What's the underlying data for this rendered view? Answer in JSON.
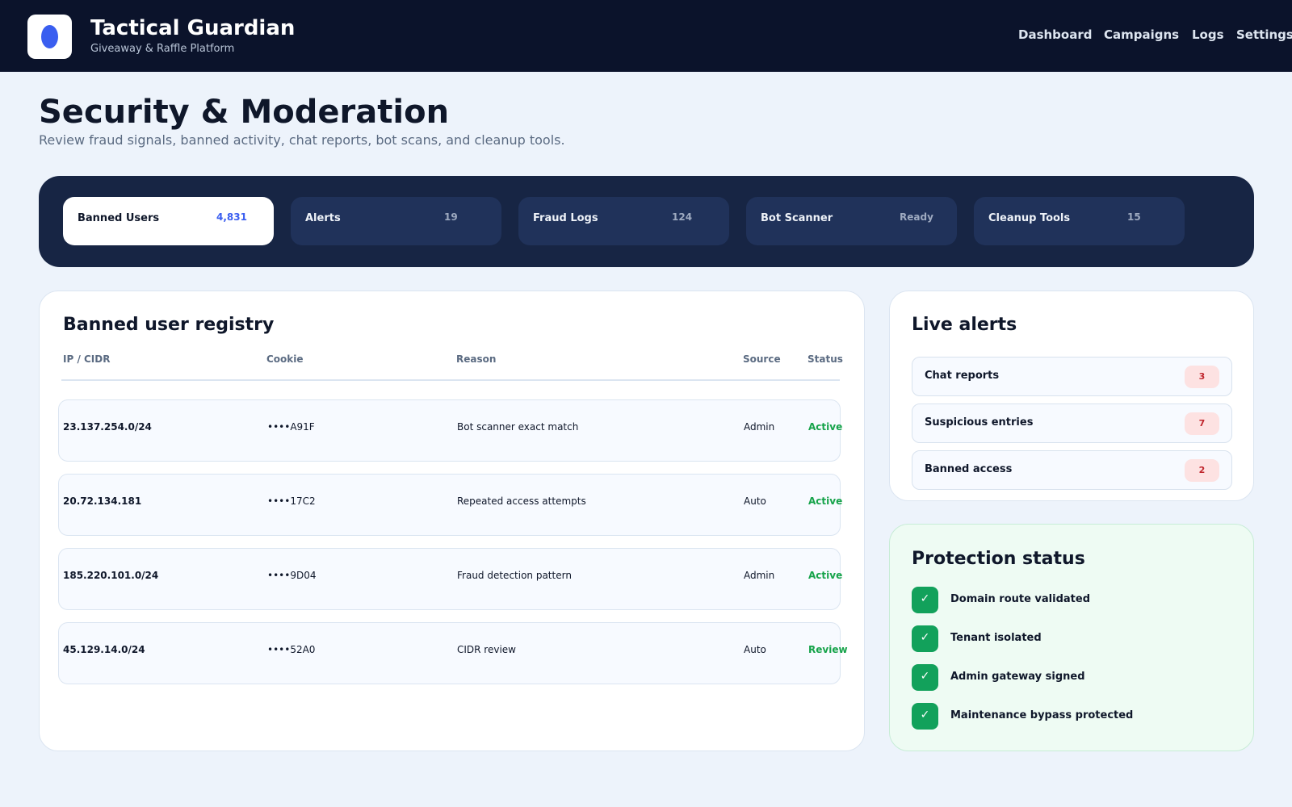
{
  "header": {
    "brand_title": "Tactical Guardian",
    "brand_subtitle": "Giveaway & Raffle Platform",
    "nav": [
      "Dashboard",
      "Campaigns",
      "Logs",
      "Settings"
    ]
  },
  "page": {
    "title": "Security & Moderation",
    "subtitle": "Review fraud signals, banned activity, chat reports, bot scans, and cleanup tools."
  },
  "tabs": [
    {
      "label": "Banned Users",
      "count": "4,831",
      "active": true
    },
    {
      "label": "Alerts",
      "count": "19",
      "active": false
    },
    {
      "label": "Fraud Logs",
      "count": "124",
      "active": false
    },
    {
      "label": "Bot Scanner",
      "count": "Ready",
      "active": false
    },
    {
      "label": "Cleanup Tools",
      "count": "15",
      "active": false
    }
  ],
  "registry": {
    "title": "Banned user registry",
    "columns": [
      "IP / CIDR",
      "Cookie",
      "Reason",
      "Source",
      "Status"
    ],
    "rows": [
      {
        "ip": "23.137.254.0/24",
        "cookie": "••••A91F",
        "reason": "Bot scanner exact match",
        "source": "Admin",
        "status": "Active"
      },
      {
        "ip": "20.72.134.181",
        "cookie": "••••17C2",
        "reason": "Repeated access attempts",
        "source": "Auto",
        "status": "Active"
      },
      {
        "ip": "185.220.101.0/24",
        "cookie": "••••9D04",
        "reason": "Fraud detection pattern",
        "source": "Admin",
        "status": "Active"
      },
      {
        "ip": "45.129.14.0/24",
        "cookie": "••••52A0",
        "reason": "CIDR review",
        "source": "Auto",
        "status": "Review"
      }
    ]
  },
  "alerts": {
    "title": "Live alerts",
    "items": [
      {
        "label": "Chat reports",
        "count": "3"
      },
      {
        "label": "Suspicious entries",
        "count": "7"
      },
      {
        "label": "Banned access",
        "count": "2"
      }
    ]
  },
  "protection": {
    "title": "Protection status",
    "check_glyph": "✓",
    "items": [
      "Domain route validated",
      "Tenant isolated",
      "Admin gateway signed",
      "Maintenance bypass protected"
    ]
  },
  "colors": {
    "topbar": "#0b132b",
    "accent": "#3a5ef0",
    "tabs_bar": "#172544",
    "status_active": "#16a34a",
    "alert_badge": "#fde2e2",
    "check": "#12a15b"
  }
}
